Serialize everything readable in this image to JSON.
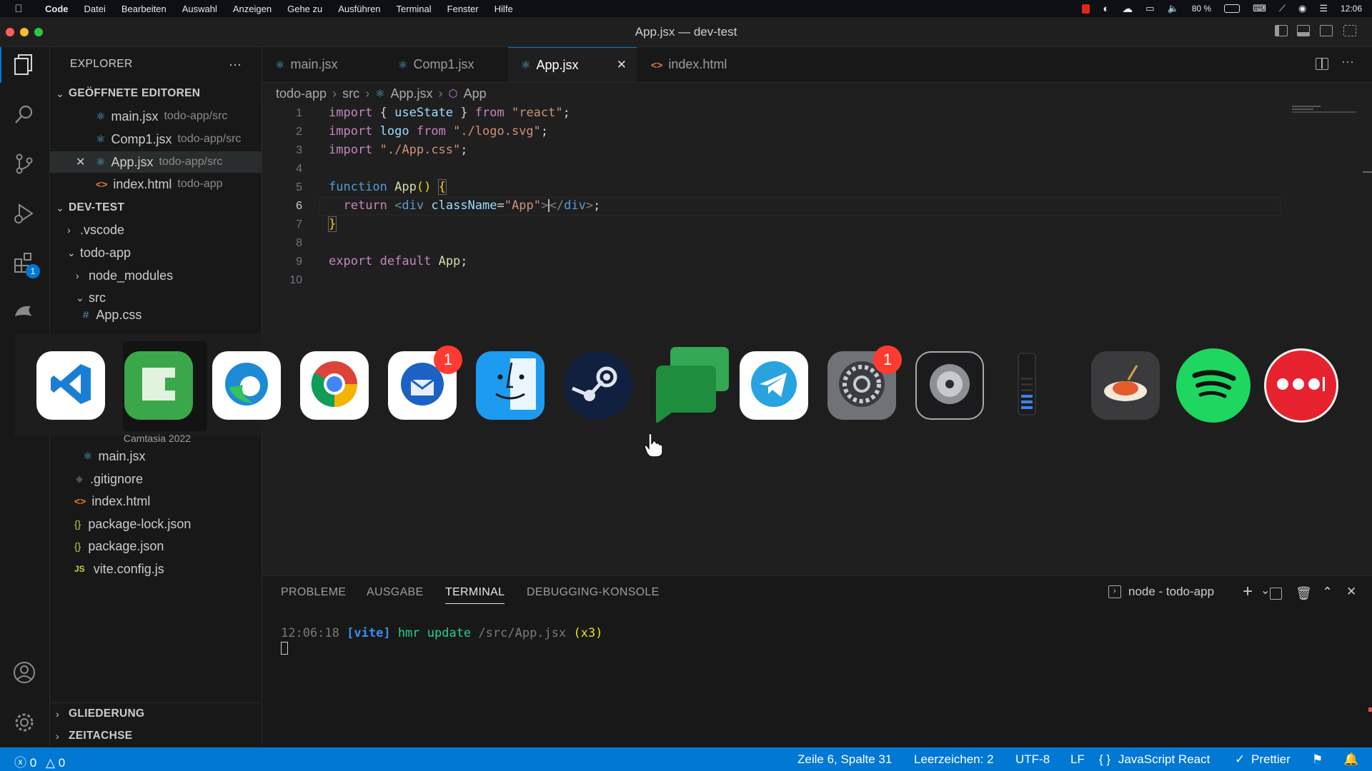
{
  "menubar": {
    "app": "Code",
    "items": [
      "Datei",
      "Bearbeiten",
      "Auswahl",
      "Anzeigen",
      "Gehe zu",
      "Ausführen",
      "Terminal",
      "Fenster",
      "Hilfe"
    ],
    "battery": "80 %",
    "clock": "12:06"
  },
  "window": {
    "title": "App.jsx — dev-test"
  },
  "activity": {
    "extensions_badge": "1"
  },
  "sidebar": {
    "title": "EXPLORER",
    "more": "···",
    "open_editors": {
      "title": "GEÖFFNETE EDITOREN",
      "items": [
        {
          "name": "main.jsx",
          "path": "todo-app/src"
        },
        {
          "name": "Comp1.jsx",
          "path": "todo-app/src"
        },
        {
          "name": "App.jsx",
          "path": "todo-app/src"
        },
        {
          "name": "index.html",
          "path": "todo-app"
        }
      ]
    },
    "workspace": {
      "title": "DEV-TEST",
      "items": [
        ".vscode",
        "todo-app",
        "node_modules",
        "src",
        "App.css",
        "main.jsx",
        ".gitignore",
        "index.html",
        "package-lock.json",
        "package.json",
        "vite.config.js"
      ]
    },
    "outline": "GLIEDERUNG",
    "timeline": "ZEITACHSE"
  },
  "tabs": [
    "main.jsx",
    "Comp1.jsx",
    "App.jsx",
    "index.html"
  ],
  "breadcrumb": [
    "todo-app",
    "src",
    "App.jsx",
    "App"
  ],
  "editor": {
    "line_numbers": [
      "1",
      "2",
      "3",
      "4",
      "5",
      "6",
      "7",
      "8",
      "9",
      "10"
    ],
    "current_line": "6"
  },
  "dock": {
    "apps": [
      "Visual Studio Code",
      "Camtasia 2022",
      "Microsoft Edge",
      "Google Chrome",
      "Thunderbird",
      "Finder",
      "Steam",
      "Google Chat",
      "Telegram",
      "System Settings",
      "Logic Pro",
      "Audio meter",
      "Pasta app",
      "Spotify",
      "Ellipsis app"
    ],
    "hover_label": "Camtasia 2022",
    "badge_thunderbird": "1",
    "badge_settings": "1"
  },
  "panel": {
    "tabs": [
      "PROBLEME",
      "AUSGABE",
      "TERMINAL",
      "DEBUGGING-KONSOLE"
    ],
    "active_tab": "TERMINAL",
    "terminal_name": "node - todo-app",
    "log": {
      "time": "12:06:18",
      "tag": "[vite]",
      "msg": "hmr update",
      "path": "/src/App.jsx",
      "count": "(x3)"
    }
  },
  "status": {
    "errors": "0",
    "warnings": "0",
    "position": "Zeile 6, Spalte 31",
    "spaces": "Leerzeichen: 2",
    "encoding": "UTF-8",
    "eol": "LF",
    "language": "JavaScript React",
    "prettier": "Prettier"
  },
  "colors": {
    "accent": "#0078d4",
    "badge": "#ff3b30"
  }
}
